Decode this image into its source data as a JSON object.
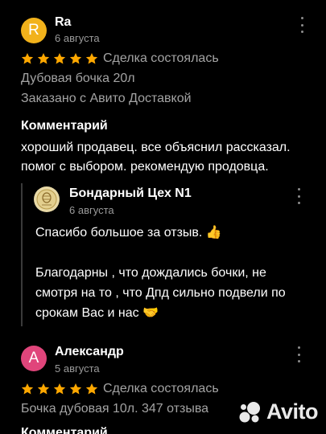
{
  "reviews": [
    {
      "avatar_letter": "R",
      "avatar_color": "#f2b21b",
      "author": "Ra",
      "date": "6 августа",
      "rating": 5,
      "deal_status": "Сделка состоялась",
      "item": "Дубовая бочка 20л",
      "delivery": "Заказано с Авито Доставкой",
      "comment_title": "Комментарий",
      "comment_lines": [
        "хороший продавец. все объяснил рассказал.",
        "помог с выбором. рекомендую продовца."
      ],
      "reply": {
        "seller_name": "Бондарный Цех N1",
        "date": "6 августа",
        "text_1": "Спасибо большое за отзыв. 👍",
        "text_2_lines": [
          "Благодарны , что дождались бочки, не",
          "смотря на то , что Дпд сильно подвели по",
          "срокам Вас и нас 🤝"
        ]
      }
    },
    {
      "avatar_letter": "А",
      "avatar_color": "#e0457b",
      "author": "Александр",
      "date": "5 августа",
      "rating": 5,
      "deal_status": "Сделка состоялась",
      "item": "Бочка дубовая 10л. 347 отзыва",
      "comment_title": "Комментарий"
    }
  ],
  "star_color": "#ffa800",
  "watermark": {
    "text": "Avito",
    "icon": "avito-logo-icon"
  }
}
